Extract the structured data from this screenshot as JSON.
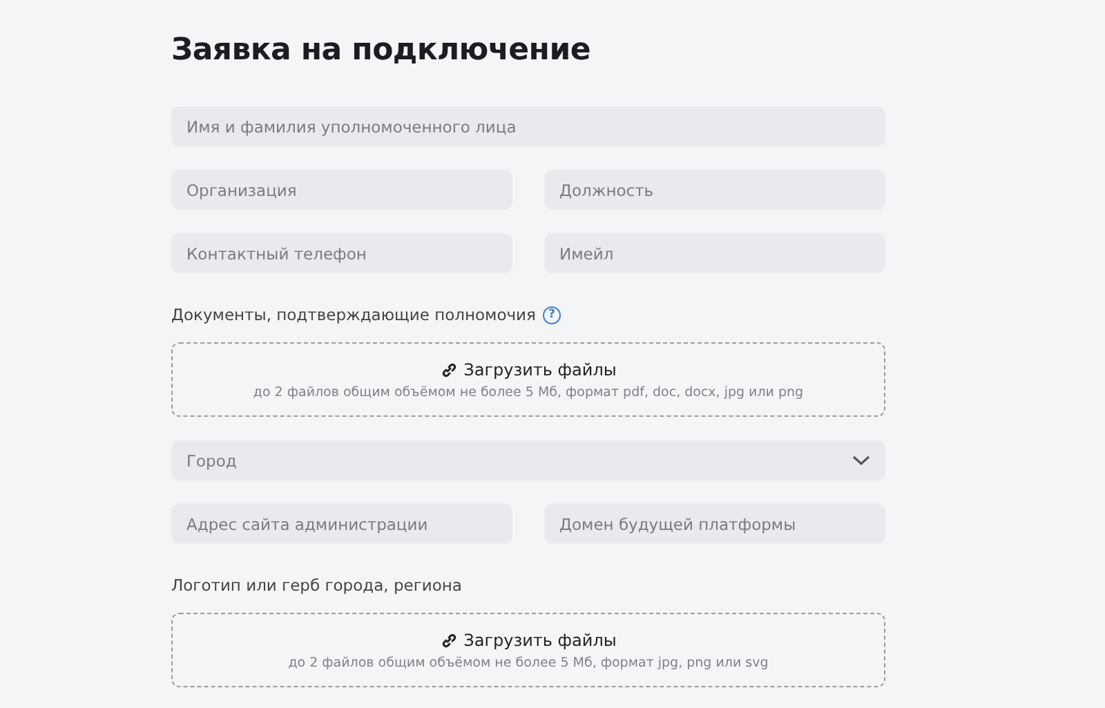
{
  "title": "Заявка на подключение",
  "form": [
    {
      "kind": "fields",
      "fields": [
        {
          "placeholder": "Имя и фамилия уполномоченного лица"
        }
      ]
    },
    {
      "kind": "fields",
      "fields": [
        {
          "placeholder": "Организация"
        },
        {
          "placeholder": "Должность"
        }
      ]
    },
    {
      "kind": "fields",
      "fields": [
        {
          "placeholder": "Контактный телефон"
        },
        {
          "placeholder": "Имейл"
        }
      ]
    },
    {
      "kind": "label",
      "text": "Документы, подтверждающие полномочия",
      "help": "?"
    },
    {
      "kind": "upload",
      "button": "Загрузить файлы",
      "hint": "до 2 файлов общим объёмом не более 5 Мб, формат pdf, doc, docx, jpg или png"
    },
    {
      "kind": "select",
      "placeholder": "Город"
    },
    {
      "kind": "fields",
      "fields": [
        {
          "placeholder": "Адрес сайта администрации"
        },
        {
          "placeholder": "Домен будущей платформы"
        }
      ]
    },
    {
      "kind": "label",
      "text": "Логотип или герб города, региона"
    },
    {
      "kind": "upload",
      "button": "Загрузить файлы",
      "hint": "до 2 файлов общим объёмом не более 5 Мб, формат jpg, png или svg"
    }
  ]
}
